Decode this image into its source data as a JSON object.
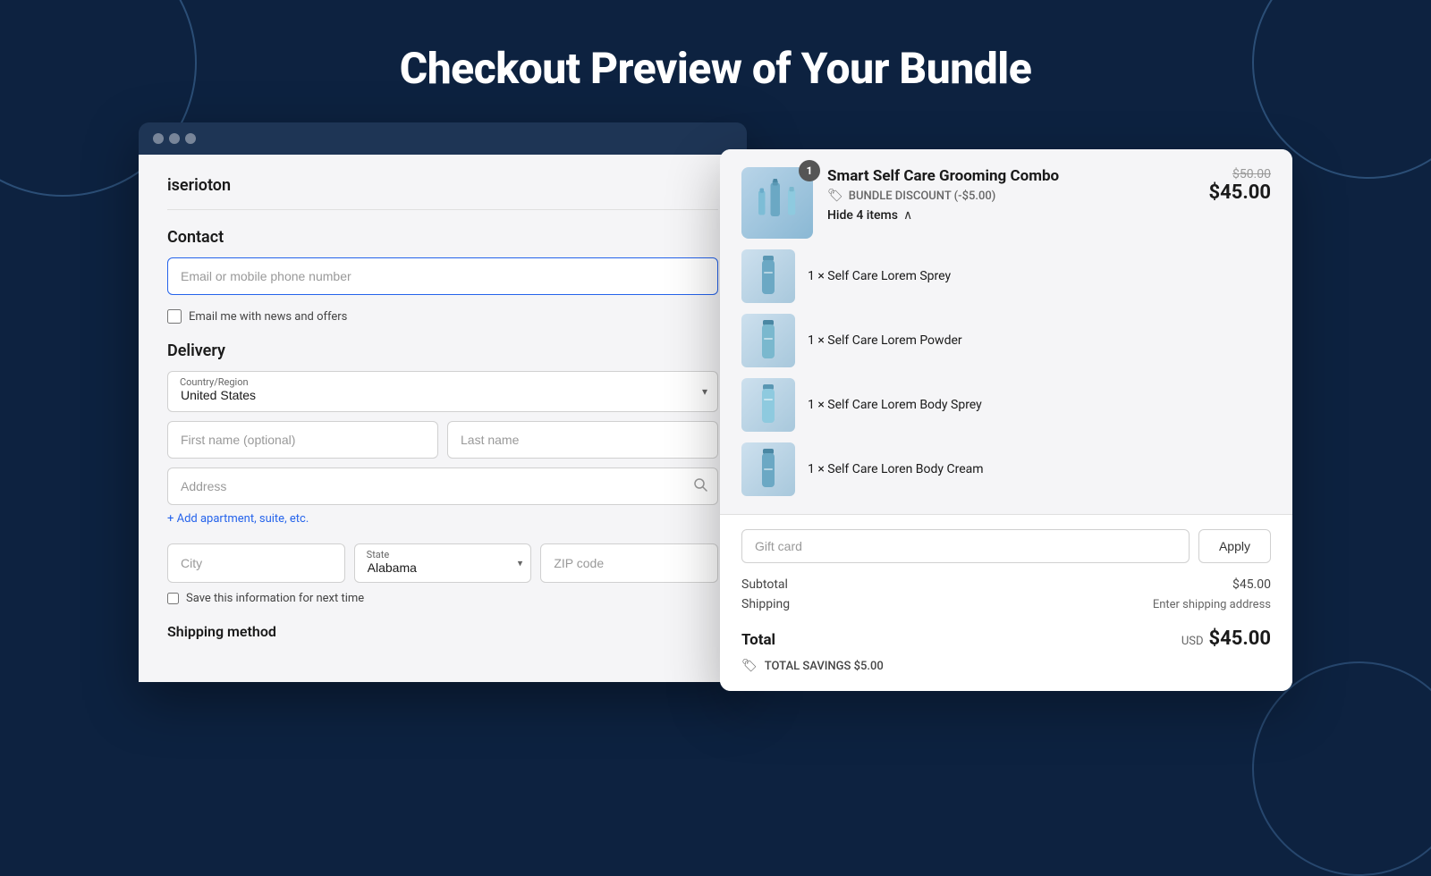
{
  "page": {
    "title": "Checkout Preview of Your Bundle",
    "bg_color": "#0d2240"
  },
  "browser": {
    "dots": [
      "dot1",
      "dot2",
      "dot3"
    ]
  },
  "checkout_form": {
    "store_name": "iserioton",
    "contact_section_label": "Contact",
    "email_placeholder": "Email or mobile phone number",
    "news_checkbox_label": "Email me with news and offers",
    "delivery_section_label": "Delivery",
    "country_label": "Country/Region",
    "country_value": "United States",
    "first_name_placeholder": "First name (optional)",
    "last_name_placeholder": "Last name",
    "address_placeholder": "Address",
    "add_apartment_label": "+ Add apartment, suite, etc.",
    "city_placeholder": "City",
    "state_label": "State",
    "state_value": "Alabama",
    "zip_placeholder": "ZIP code",
    "save_info_label": "Save this information for next time",
    "shipping_method_label": "Shipping method"
  },
  "order_summary": {
    "bundle_image_alt": "grooming products",
    "badge_count": "1",
    "bundle_name": "Smart Self Care Grooming Combo",
    "discount_label": "BUNDLE DISCOUNT (-$5.00)",
    "original_price": "$50.00",
    "sale_price": "$45.00",
    "hide_items_label": "Hide 4 items",
    "items": [
      {
        "name": "1 × Self Care Lorem Sprey",
        "image_alt": "spray bottle"
      },
      {
        "name": "1 × Self Care Lorem Powder",
        "image_alt": "powder bottle"
      },
      {
        "name": "1 × Self Care Lorem Body Sprey",
        "image_alt": "body spray"
      },
      {
        "name": "1 × Self Care Loren Body Cream",
        "image_alt": "body cream"
      }
    ],
    "gift_card_placeholder": "Gift card",
    "apply_button_label": "Apply",
    "subtotal_label": "Subtotal",
    "subtotal_value": "$45.00",
    "shipping_label": "Shipping",
    "shipping_value": "Enter shipping address",
    "total_label": "Total",
    "total_currency": "USD",
    "total_value": "$45.00",
    "savings_label": "TOTAL SAVINGS",
    "savings_value": "$5.00"
  }
}
